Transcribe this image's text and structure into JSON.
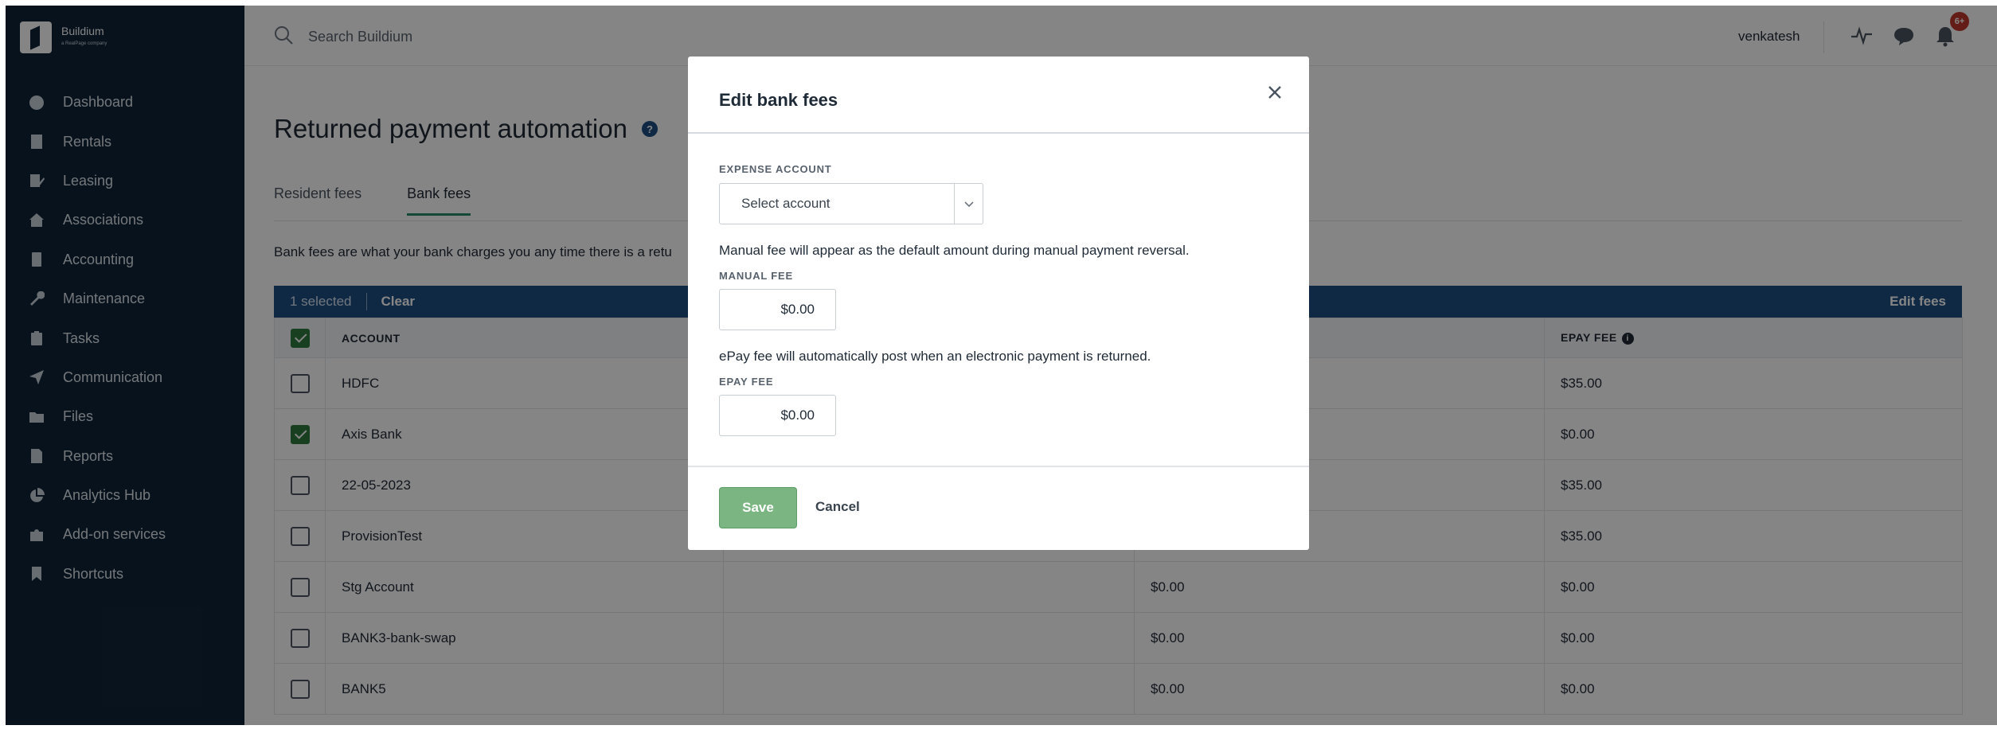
{
  "app": {
    "logo_name": "Buildium",
    "logo_tagline": "a RealPage company"
  },
  "sidebar": {
    "items": [
      {
        "label": "Dashboard",
        "icon": "dashboard-icon"
      },
      {
        "label": "Rentals",
        "icon": "building-icon"
      },
      {
        "label": "Leasing",
        "icon": "lease-icon"
      },
      {
        "label": "Associations",
        "icon": "house-icon"
      },
      {
        "label": "Accounting",
        "icon": "calculator-icon"
      },
      {
        "label": "Maintenance",
        "icon": "wrench-icon"
      },
      {
        "label": "Tasks",
        "icon": "clipboard-icon"
      },
      {
        "label": "Communication",
        "icon": "send-icon"
      },
      {
        "label": "Files",
        "icon": "folder-icon"
      },
      {
        "label": "Reports",
        "icon": "report-icon"
      },
      {
        "label": "Analytics Hub",
        "icon": "pie-chart-icon"
      },
      {
        "label": "Add-on services",
        "icon": "puzzle-icon"
      },
      {
        "label": "Shortcuts",
        "icon": "bookmark-icon"
      }
    ]
  },
  "topbar": {
    "search_placeholder": "Search Buildium",
    "username": "venkatesh",
    "notification_badge": "6+"
  },
  "page": {
    "title": "Returned payment automation",
    "tabs": [
      {
        "label": "Resident fees",
        "active": false
      },
      {
        "label": "Bank fees",
        "active": true
      }
    ],
    "description": "Bank fees are what your bank charges you any time there is a retu"
  },
  "bulk_bar": {
    "selected_text": "1 selected",
    "clear_label": "Clear",
    "edit_label": "Edit fees"
  },
  "table": {
    "headers": [
      "ACCOUNT",
      "",
      "",
      "EPAY FEE"
    ],
    "rows": [
      {
        "account": "HDFC",
        "expense": "",
        "manual": "",
        "epay": "$35.00",
        "checked": false
      },
      {
        "account": "Axis Bank",
        "expense": "",
        "manual": "",
        "epay": "$0.00",
        "checked": true
      },
      {
        "account": "22-05-2023",
        "expense": "",
        "manual": "",
        "epay": "$35.00",
        "checked": false
      },
      {
        "account": "ProvisionTest",
        "expense": "",
        "manual": "",
        "epay": "$35.00",
        "checked": false
      },
      {
        "account": "Stg Account",
        "expense": "",
        "manual": "$0.00",
        "epay": "$0.00",
        "checked": false
      },
      {
        "account": "BANK3-bank-swap",
        "expense": "",
        "manual": "$0.00",
        "epay": "$0.00",
        "checked": false
      },
      {
        "account": "BANK5",
        "expense": "",
        "manual": "$0.00",
        "epay": "$0.00",
        "checked": false
      }
    ]
  },
  "modal": {
    "title": "Edit bank fees",
    "expense_label": "EXPENSE ACCOUNT",
    "expense_placeholder": "Select account",
    "manual_hint": "Manual fee will appear as the default amount during manual payment reversal.",
    "manual_label": "MANUAL FEE",
    "manual_value": "$0.00",
    "epay_hint": "ePay fee will automatically post when an electronic payment is returned.",
    "epay_label": "EPAY FEE",
    "epay_value": "$0.00",
    "save_label": "Save",
    "cancel_label": "Cancel"
  },
  "colors": {
    "sidebar_bg": "#0f2438",
    "bulk_bar_bg": "#1d4f84",
    "save_button": "#7bb581",
    "checkbox_checked": "#2f7a3c"
  }
}
